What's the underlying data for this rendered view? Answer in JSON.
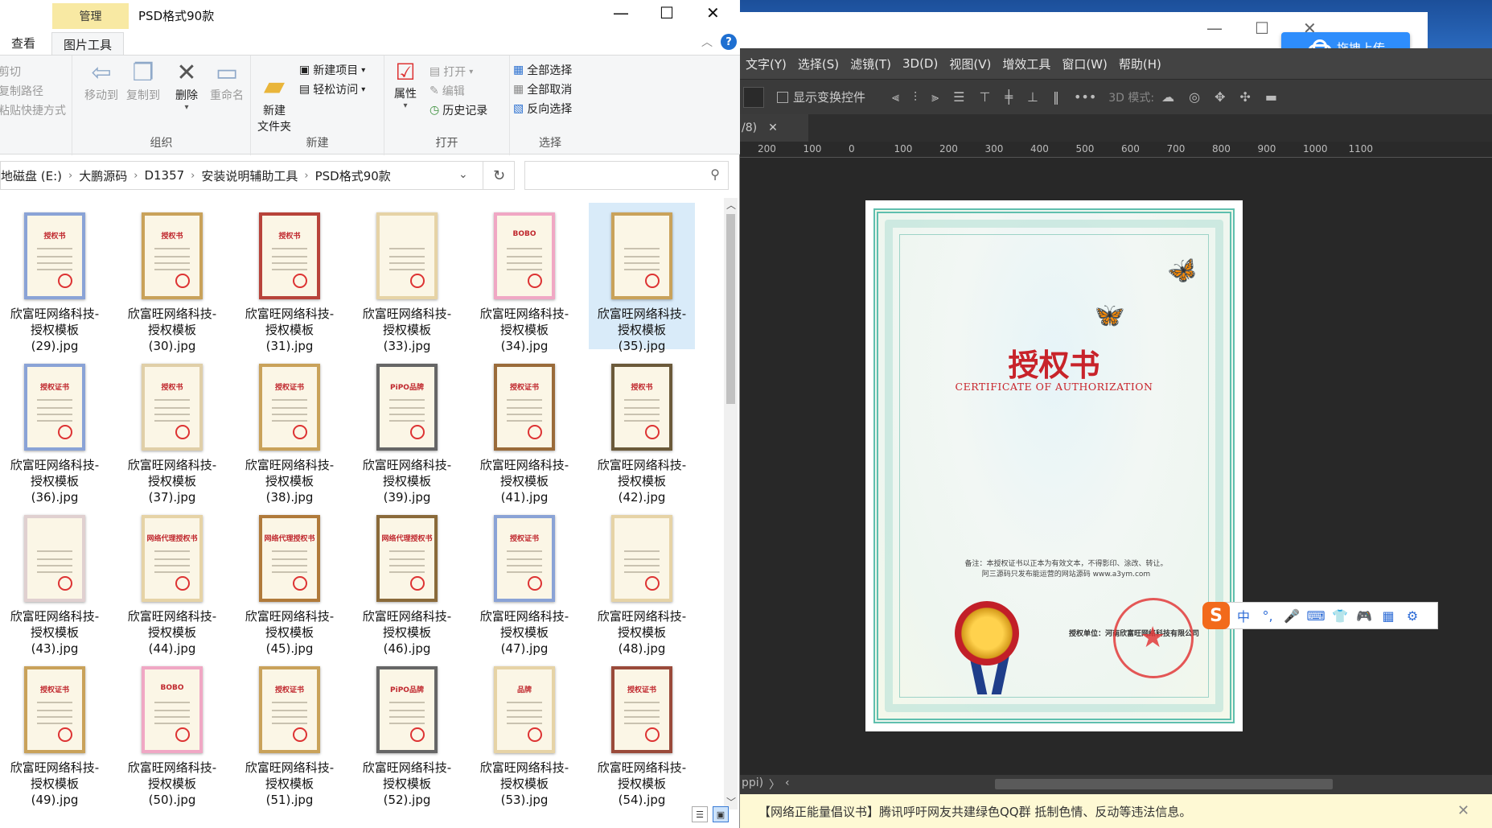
{
  "explorer": {
    "context_tab": "管理",
    "title": "PSD格式90款",
    "tabs": [
      "查看",
      "图片工具"
    ],
    "ribbon": {
      "clipboard": [
        "剪切",
        "复制路径",
        "粘贴快捷方式"
      ],
      "organize": {
        "move_to": "移动到",
        "copy_to": "复制到",
        "delete": "删除",
        "rename": "重命名",
        "label": "组织"
      },
      "new": {
        "new_folder": "新建\n文件夹",
        "new_item": "新建项目",
        "easy_access": "轻松访问",
        "label": "新建"
      },
      "open": {
        "properties": "属性",
        "open": "打开",
        "edit": "编辑",
        "history": "历史记录",
        "label": "打开"
      },
      "select": {
        "select_all": "全部选择",
        "select_none": "全部取消",
        "invert": "反向选择",
        "label": "选择"
      }
    },
    "address": [
      "地磁盘 (E:)",
      "大鹏源码",
      "D1357",
      "安装说明辅助工具",
      "PSD格式90款"
    ],
    "files": [
      {
        "l1": "欣富旺网络科技-",
        "l2": "授权模板",
        "l3": "(29).jpg"
      },
      {
        "l1": "欣富旺网络科技-",
        "l2": "授权模板",
        "l3": "(30).jpg"
      },
      {
        "l1": "欣富旺网络科技-",
        "l2": "授权模板",
        "l3": "(31).jpg"
      },
      {
        "l1": "欣富旺网络科技-",
        "l2": "授权模板",
        "l3": "(33).jpg"
      },
      {
        "l1": "欣富旺网络科技-",
        "l2": "授权模板",
        "l3": "(34).jpg"
      },
      {
        "l1": "欣富旺网络科技-",
        "l2": "授权模板",
        "l3": "(35).jpg"
      },
      {
        "l1": "欣富旺网络科技-",
        "l2": "授权模板",
        "l3": "(36).jpg"
      },
      {
        "l1": "欣富旺网络科技-",
        "l2": "授权模板",
        "l3": "(37).jpg"
      },
      {
        "l1": "欣富旺网络科技-",
        "l2": "授权模板",
        "l3": "(38).jpg"
      },
      {
        "l1": "欣富旺网络科技-",
        "l2": "授权模板",
        "l3": "(39).jpg"
      },
      {
        "l1": "欣富旺网络科技-",
        "l2": "授权模板",
        "l3": "(41).jpg"
      },
      {
        "l1": "欣富旺网络科技-",
        "l2": "授权模板",
        "l3": "(42).jpg"
      },
      {
        "l1": "欣富旺网络科技-",
        "l2": "授权模板",
        "l3": "(43).jpg"
      },
      {
        "l1": "欣富旺网络科技-",
        "l2": "授权模板",
        "l3": "(44).jpg"
      },
      {
        "l1": "欣富旺网络科技-",
        "l2": "授权模板",
        "l3": "(45).jpg"
      },
      {
        "l1": "欣富旺网络科技-",
        "l2": "授权模板",
        "l3": "(46).jpg"
      },
      {
        "l1": "欣富旺网络科技-",
        "l2": "授权模板",
        "l3": "(47).jpg"
      },
      {
        "l1": "欣富旺网络科技-",
        "l2": "授权模板",
        "l3": "(48).jpg"
      },
      {
        "l1": "欣富旺网络科技-",
        "l2": "授权模板",
        "l3": "(49).jpg"
      },
      {
        "l1": "欣富旺网络科技-",
        "l2": "授权模板",
        "l3": "(50).jpg"
      },
      {
        "l1": "欣富旺网络科技-",
        "l2": "授权模板",
        "l3": "(51).jpg"
      },
      {
        "l1": "欣富旺网络科技-",
        "l2": "授权模板",
        "l3": "(52).jpg"
      },
      {
        "l1": "欣富旺网络科技-",
        "l2": "授权模板",
        "l3": "(53).jpg"
      },
      {
        "l1": "欣富旺网络科技-",
        "l2": "授权模板",
        "l3": "(54).jpg"
      }
    ],
    "thumb_titles": [
      "授权书",
      "授权书",
      "授权书",
      "",
      "BOBO",
      "",
      "授权证书",
      "授权书",
      "授权证书",
      "PiPO品牌",
      "授权证书",
      "授权书",
      "",
      "网络代理授权书",
      "网络代理授权书",
      "网络代理授权书",
      "授权证书",
      "",
      "授权证书",
      "BOBO",
      "授权证书",
      "PiPO品牌",
      "品牌",
      "授权证书"
    ],
    "selected_index": 5
  },
  "photoshop": {
    "menu": [
      "文字(Y)",
      "选择(S)",
      "滤镜(T)",
      "3D(D)",
      "视图(V)",
      "增效工具",
      "窗口(W)",
      "帮助(H)"
    ],
    "options": {
      "show_transform": "显示变换控件",
      "mode_3d": "3D 模式:"
    },
    "doc_tab": "/8)",
    "ruler": [
      "200",
      "100",
      "0",
      "100",
      "200",
      "300",
      "400",
      "500",
      "600",
      "700",
      "800",
      "900",
      "1000",
      "1100"
    ],
    "status": "ppi)",
    "upload_label": "拖拽上传",
    "notice": "【网络正能量倡议书】腾讯呼吁网友共建绿色QQ群 抵制色情、反动等违法信息。",
    "certificate": {
      "title": "授权书",
      "subtitle": "CERTIFICATE OF AUTHORIZATION",
      "note": "备注：本授权证书以正本为有效文本，不得影印、涂改、转让。\n阿三源码只发布能运营的网站源码 www.a3ym.com",
      "unit": "授权单位：河南欣富旺网络科技有限公司"
    }
  },
  "ime": {
    "mode": "中",
    "punct": "°,"
  }
}
